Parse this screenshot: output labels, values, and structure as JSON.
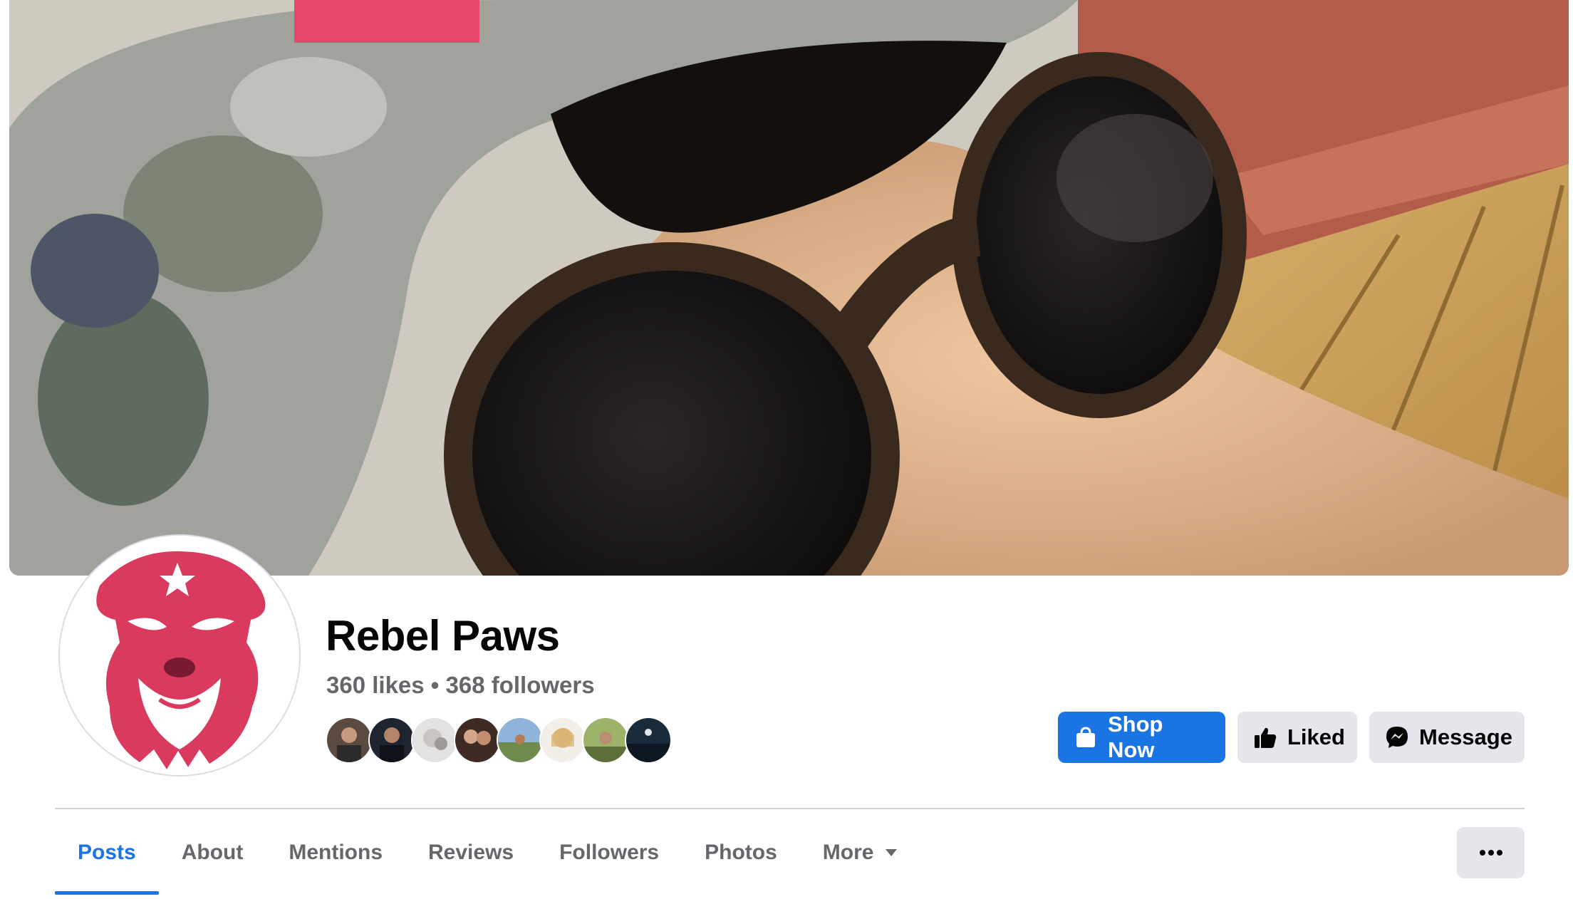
{
  "page": {
    "name": "Rebel Paws",
    "stats": "360 likes • 368 followers"
  },
  "actions": {
    "shop_label": "Shop Now",
    "liked_label": "Liked",
    "message_label": "Message"
  },
  "tabs": [
    {
      "label": "Posts",
      "active": true
    },
    {
      "label": "About"
    },
    {
      "label": "Mentions"
    },
    {
      "label": "Reviews"
    },
    {
      "label": "Followers"
    },
    {
      "label": "Photos"
    },
    {
      "label": "More"
    }
  ],
  "icons": {
    "shop": "shopping-bag-icon",
    "liked": "thumbs-up-icon",
    "message": "messenger-icon",
    "more_caret": "caret-down-icon",
    "overflow": "ellipsis-icon"
  },
  "colors": {
    "accent": "#1b74e4",
    "secondary_button": "#e4e6eb",
    "muted_text": "#65676b",
    "logo_red": "#d93a5e"
  }
}
